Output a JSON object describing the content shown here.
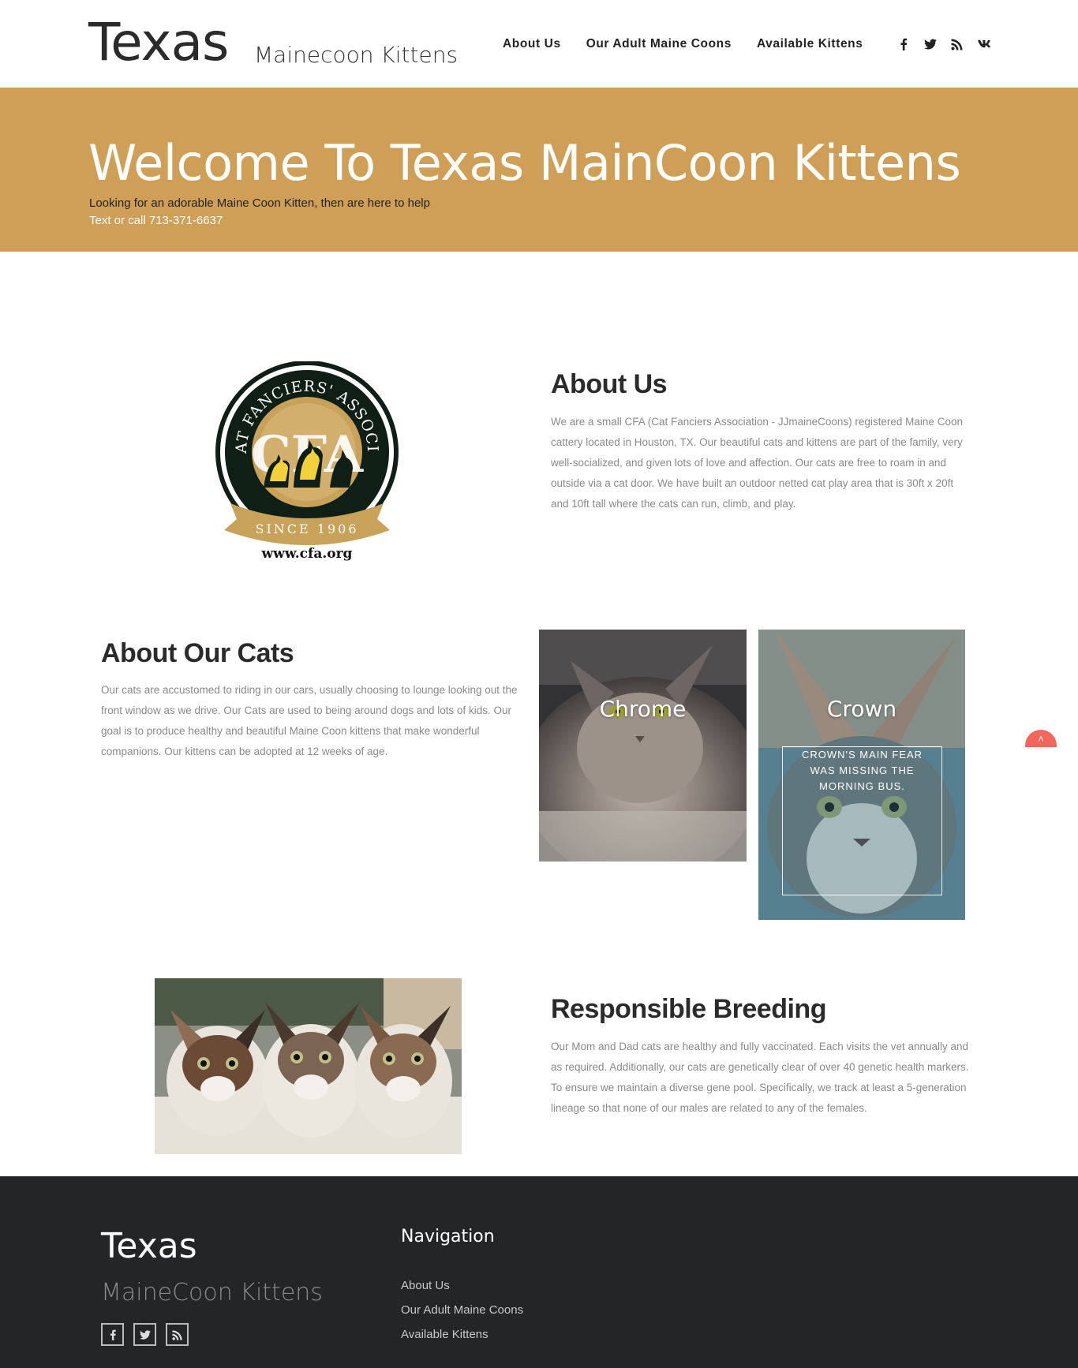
{
  "header": {
    "logo_main": "Texas",
    "logo_sub": "Mainecoon Kittens",
    "nav": [
      {
        "label": "About Us"
      },
      {
        "label": "Our Adult Maine Coons"
      },
      {
        "label": "Available Kittens"
      }
    ],
    "social_icons": [
      "facebook-icon",
      "twitter-icon",
      "rss-icon",
      "vk-icon"
    ]
  },
  "hero": {
    "title": "Welcome To Texas MainCoon Kittens",
    "line1": "Looking for an adorable Maine Coon Kitten, then are here to help",
    "line2": "Text or call 713-371-6637",
    "background_color": "#cf9f57"
  },
  "cfa_logo": {
    "ring_text": "THE CAT FANCIERS' ASSOCIATION",
    "since": "SINCE 1906",
    "website": "www.cfa.org",
    "letters": "CFA"
  },
  "about": {
    "title": "About Us",
    "text": "We are a small CFA (Cat Fanciers Association - JJmaineCoons) registered Maine Coon cattery located in Houston, TX. Our beautiful cats and kittens are part of the family, very well-socialized, and given lots of love and affection. Our cats are free to roam in and outside via a cat door. We have built an outdoor netted cat play area that is 30ft x 20ft and 10ft tall where the cats can run, climb, and play."
  },
  "cats": {
    "title": "About Our Cats",
    "text": "Our cats are accustomed to riding in our cars, usually choosing to lounge looking out the front window as we drive. Our Cats are used to being around dogs and lots of kids. Our goal is to produce healthy and beautiful Maine Coon kittens that make wonderful companions. Our kittens can be adopted at 12 weeks of age.",
    "cards": [
      {
        "name": "Chrome"
      },
      {
        "name": "Crown",
        "caption": "CROWN'S MAIN FEAR WAS MISSING THE MORNING BUS."
      }
    ]
  },
  "breeding": {
    "title": "Responsible Breeding",
    "text": "Our Mom and Dad cats are healthy and fully vaccinated. Each visits the vet annually and as required. Additionally, our cats are genetically clear of over 40 genetic health markers. To ensure we maintain a diverse gene pool. Specifically, we track at least a 5-generation lineage so that none of our males are related to any of the females."
  },
  "footer": {
    "logo_main": "Texas",
    "logo_sub": "MaineCoon Kittens",
    "nav_title": "Navigation",
    "nav": [
      {
        "label": "About Us"
      },
      {
        "label": "Our Adult Maine Coons"
      },
      {
        "label": "Available Kittens"
      }
    ],
    "social_icons": [
      "facebook-icon",
      "twitter-icon",
      "rss-icon"
    ]
  },
  "scroll_top": {
    "icon": "chevron-up-icon",
    "color": "#f2665c"
  }
}
